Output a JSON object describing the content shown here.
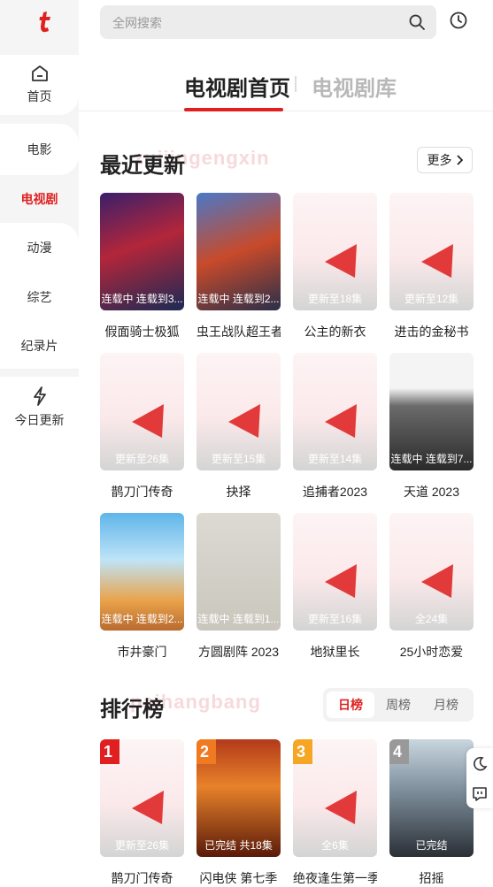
{
  "sidebar": {
    "logo": "logo",
    "items": [
      {
        "label": "首页",
        "icon": "home-icon"
      },
      {
        "label": "电影"
      },
      {
        "label": "电视剧"
      },
      {
        "label": "动漫"
      },
      {
        "label": "综艺"
      },
      {
        "label": "纪录片"
      },
      {
        "label": "今日更新",
        "icon": "lightning-icon"
      }
    ]
  },
  "search": {
    "placeholder": "全网搜索"
  },
  "tabs": [
    "电视剧首页",
    "电视剧库"
  ],
  "recent": {
    "title": "最近更新",
    "ghost": "zuijingengxin",
    "more": "更多",
    "items": [
      {
        "title": "假面骑士极狐",
        "badge": "连载中 连载到3..."
      },
      {
        "title": "虫王战队超王者",
        "badge": "连载中 连载到2..."
      },
      {
        "title": "公主的新衣",
        "badge": "更新至18集"
      },
      {
        "title": "进击的金秘书",
        "badge": "更新至12集"
      },
      {
        "title": "鹊刀门传奇",
        "badge": "更新至26集"
      },
      {
        "title": "抉择",
        "badge": "更新至15集"
      },
      {
        "title": "追捕者2023",
        "badge": "更新至14集"
      },
      {
        "title": "天道 2023",
        "badge": "连载中 连载到7..."
      },
      {
        "title": "市井豪门",
        "badge": "连载中 连载到2..."
      },
      {
        "title": "方圆剧阵 2023",
        "badge": "连载中 连载到1..."
      },
      {
        "title": "地狱里长",
        "badge": "更新至16集"
      },
      {
        "title": "25小时恋爱",
        "badge": "全24集"
      }
    ]
  },
  "ranking": {
    "title": "排行榜",
    "ghost": "paihangbang",
    "tabs": [
      "日榜",
      "周榜",
      "月榜"
    ],
    "items": [
      {
        "rank": "1",
        "title": "鹊刀门传奇",
        "badge": "更新至26集"
      },
      {
        "rank": "2",
        "title": "闪电侠 第七季",
        "badge": "已完结 共18集"
      },
      {
        "rank": "3",
        "title": "绝夜逢生第一季",
        "badge": "全6集"
      },
      {
        "rank": "4",
        "title": "招摇",
        "badge": "已完结"
      }
    ]
  },
  "colors": {
    "accent": "#e02020",
    "rank1": "#e02020",
    "rank2": "#f07a20",
    "rank3": "#f5a623",
    "rank4": "#999999"
  }
}
